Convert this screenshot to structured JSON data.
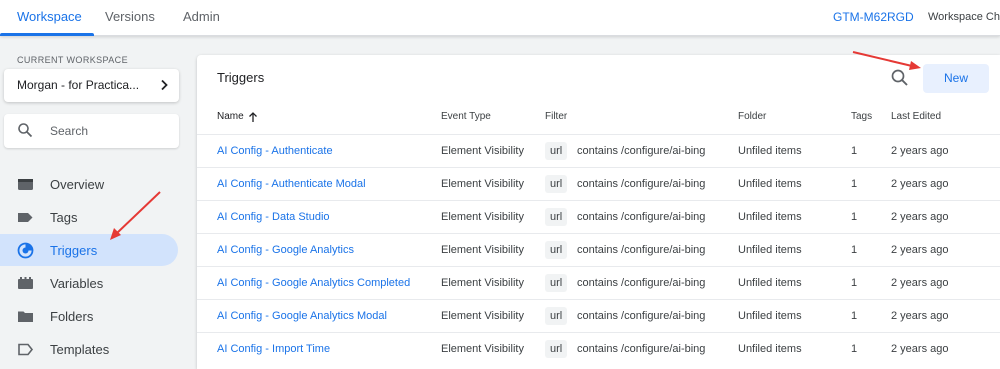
{
  "topbar": {
    "tabs": [
      {
        "label": "Workspace",
        "active": true
      },
      {
        "label": "Versions",
        "active": false
      },
      {
        "label": "Admin",
        "active": false
      }
    ],
    "container_id": "GTM-M62RGD",
    "workspace_changes": "Workspace Cha"
  },
  "sidebar": {
    "current_workspace_label": "CURRENT WORKSPACE",
    "workspace_name": "Morgan - for Practica...",
    "search_placeholder": "Search",
    "items": [
      {
        "label": "Overview",
        "icon": "overview-icon",
        "active": false
      },
      {
        "label": "Tags",
        "icon": "tag-icon",
        "active": false
      },
      {
        "label": "Triggers",
        "icon": "triggers-icon",
        "active": true
      },
      {
        "label": "Variables",
        "icon": "variables-icon",
        "active": false
      },
      {
        "label": "Folders",
        "icon": "folder-icon",
        "active": false
      },
      {
        "label": "Templates",
        "icon": "template-icon",
        "active": false
      }
    ]
  },
  "main": {
    "title": "Triggers",
    "new_button": "New",
    "columns": [
      "Name",
      "Event Type",
      "Filter",
      "Folder",
      "Tags",
      "Last Edited"
    ],
    "rows": [
      {
        "name": "AI Config - Authenticate",
        "event_type": "Element Visibility",
        "filter_var": "url",
        "filter_expr": "contains /configure/ai-bing",
        "folder": "Unfiled items",
        "tags": "1",
        "last_edited": "2 years ago"
      },
      {
        "name": "AI Config - Authenticate Modal",
        "event_type": "Element Visibility",
        "filter_var": "url",
        "filter_expr": "contains /configure/ai-bing",
        "folder": "Unfiled items",
        "tags": "1",
        "last_edited": "2 years ago"
      },
      {
        "name": "AI Config - Data Studio",
        "event_type": "Element Visibility",
        "filter_var": "url",
        "filter_expr": "contains /configure/ai-bing",
        "folder": "Unfiled items",
        "tags": "1",
        "last_edited": "2 years ago"
      },
      {
        "name": "AI Config - Google Analytics",
        "event_type": "Element Visibility",
        "filter_var": "url",
        "filter_expr": "contains /configure/ai-bing",
        "folder": "Unfiled items",
        "tags": "1",
        "last_edited": "2 years ago"
      },
      {
        "name": "AI Config - Google Analytics Completed",
        "event_type": "Element Visibility",
        "filter_var": "url",
        "filter_expr": "contains /configure/ai-bing",
        "folder": "Unfiled items",
        "tags": "1",
        "last_edited": "2 years ago"
      },
      {
        "name": "AI Config - Google Analytics Modal",
        "event_type": "Element Visibility",
        "filter_var": "url",
        "filter_expr": "contains /configure/ai-bing",
        "folder": "Unfiled items",
        "tags": "1",
        "last_edited": "2 years ago"
      },
      {
        "name": "AI Config - Import Time",
        "event_type": "Element Visibility",
        "filter_var": "url",
        "filter_expr": "contains /configure/ai-bing",
        "folder": "Unfiled items",
        "tags": "1",
        "last_edited": "2 years ago"
      }
    ]
  },
  "colors": {
    "accent": "#1a73e8",
    "active_nav_bg": "#d2e3fc",
    "new_button_bg": "#e8f0fe",
    "annotation_arrow": "#e53935"
  }
}
